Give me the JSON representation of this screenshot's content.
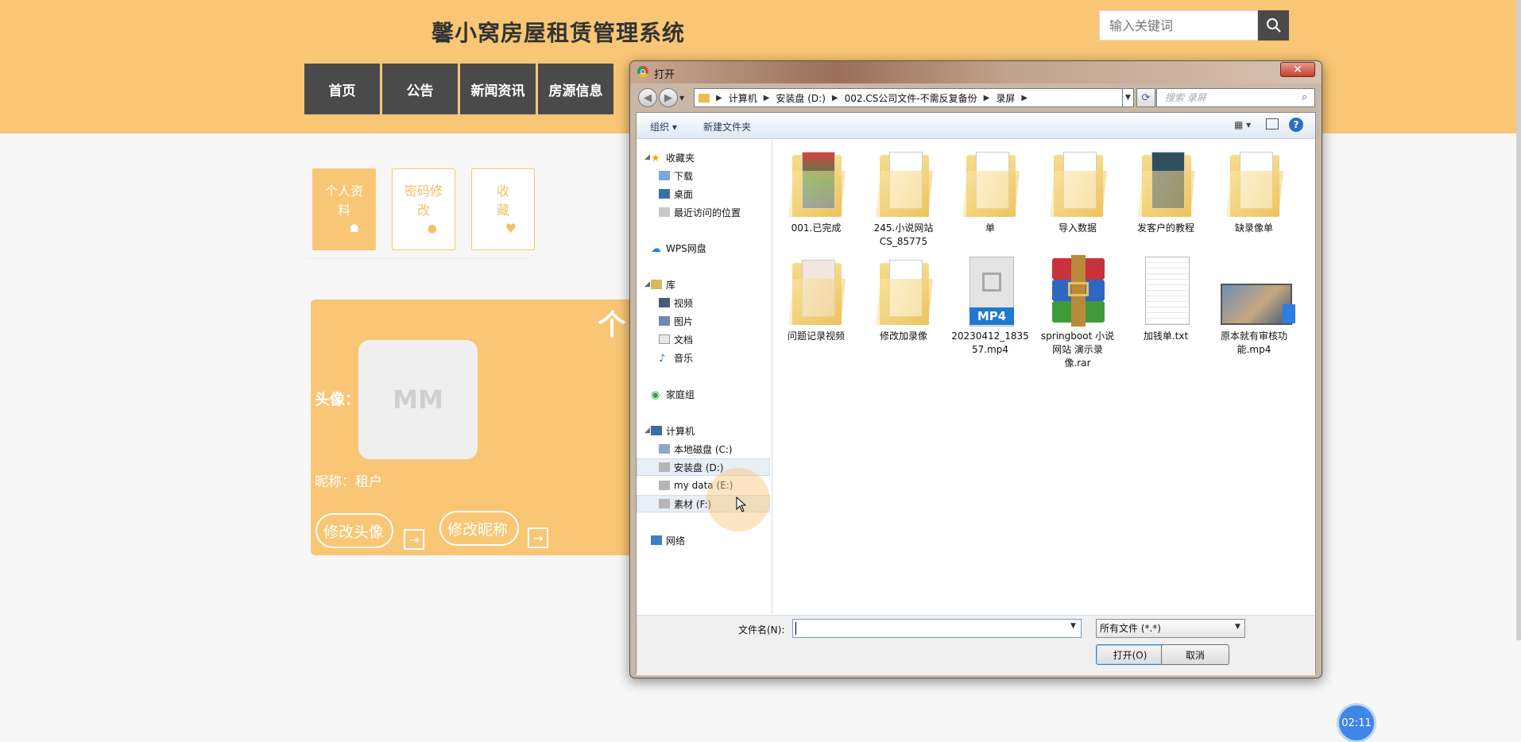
{
  "header": {
    "site_title": "馨小窝房屋租赁管理系统",
    "search_placeholder": "输入关键词",
    "nav": [
      "首页",
      "公告",
      "新闻资讯",
      "房源信息"
    ]
  },
  "side_tabs": [
    {
      "label": "个人资料",
      "icon": "home-icon",
      "active": true
    },
    {
      "label": "密码修改",
      "icon": "user-icon",
      "active": false
    },
    {
      "label": "收藏",
      "icon": "heart-icon",
      "active": false
    }
  ],
  "profile": {
    "avatar_label": "头像：",
    "avatar_text": "MM",
    "nickname_label": "昵称：",
    "nickname_value": "租户",
    "change_avatar_btn": "修改头像",
    "change_nickname_btn": "修改昵称",
    "arrow_glyph": "个"
  },
  "timer": "02:11",
  "dialog": {
    "title": "打开",
    "close_glyph": "✕",
    "breadcrumb": [
      "计算机",
      "安装盘 (D:)",
      "002.CS公司文件-不需反复备份",
      "录屏"
    ],
    "search_placeholder": "搜索 录屏",
    "toolbar": {
      "organize": "组织",
      "new_folder": "新建文件夹"
    },
    "nav_tree": {
      "favorites": "收藏夹",
      "favorites_items": [
        "下载",
        "桌面",
        "最近访问的位置"
      ],
      "wps": "WPS网盘",
      "library": "库",
      "library_items": [
        "视频",
        "图片",
        "文档",
        "音乐"
      ],
      "homegroup": "家庭组",
      "computer": "计算机",
      "drives": [
        "本地磁盘 (C:)",
        "安装盘 (D:)",
        "my data (E:)",
        "素材 (F:)"
      ],
      "network": "网络"
    },
    "files": [
      {
        "name": "001.已完成",
        "type": "folder"
      },
      {
        "name": "245.小说网站CS_85775",
        "type": "folder"
      },
      {
        "name": "单",
        "type": "folder"
      },
      {
        "name": "导入数据",
        "type": "folder"
      },
      {
        "name": "发客户的教程",
        "type": "folder"
      },
      {
        "name": "缺录像单",
        "type": "folder"
      },
      {
        "name": "问题记录视频",
        "type": "folder"
      },
      {
        "name": "修改加录像",
        "type": "folder"
      },
      {
        "name": "20230412_183557.mp4",
        "type": "mp4",
        "badge": "MP4"
      },
      {
        "name": "springboot 小说网站 演示录像.rar",
        "type": "rar"
      },
      {
        "name": "加钱单.txt",
        "type": "txt"
      },
      {
        "name": "原本就有审核功能.mp4",
        "type": "video"
      }
    ],
    "filename_label": "文件名(N):",
    "filename_value": "",
    "filetype": "所有文件 (*.*)",
    "open_btn": "打开(O)",
    "cancel_btn": "取消"
  },
  "colors": {
    "accent": "#f8c674",
    "nav_bg": "#4a4a4a"
  }
}
